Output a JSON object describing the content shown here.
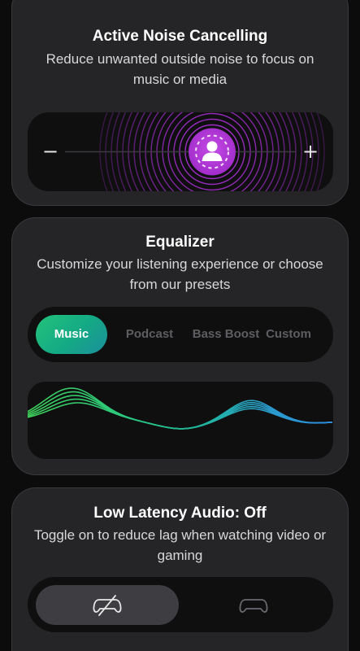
{
  "anc": {
    "title": "Active Noise Cancelling",
    "description": "Reduce unwanted outside noise to focus on music or media",
    "minus_label": "−",
    "plus_label": "+",
    "accent_color": "#b03ad6",
    "knob_icon": "person-icon"
  },
  "equalizer": {
    "title": "Equalizer",
    "description": "Customize your listening experience or choose from our presets",
    "presets": [
      {
        "label": "Music",
        "active": true
      },
      {
        "label": "Podcast",
        "active": false
      },
      {
        "label": "Bass Boost",
        "active": false
      },
      {
        "label": "Custom",
        "active": false
      }
    ],
    "accent_gradient": [
      "#23c27a",
      "#1c8f9c"
    ],
    "wave_colors": [
      "#3fd05a",
      "#22b98e",
      "#2f8fe0"
    ]
  },
  "latency": {
    "title": "Low Latency Audio: Off",
    "description": "Toggle on to reduce lag when watching video or gaming",
    "options": [
      {
        "icon": "gamepad-off-icon",
        "active": true
      },
      {
        "icon": "gamepad-icon",
        "active": false
      }
    ]
  }
}
